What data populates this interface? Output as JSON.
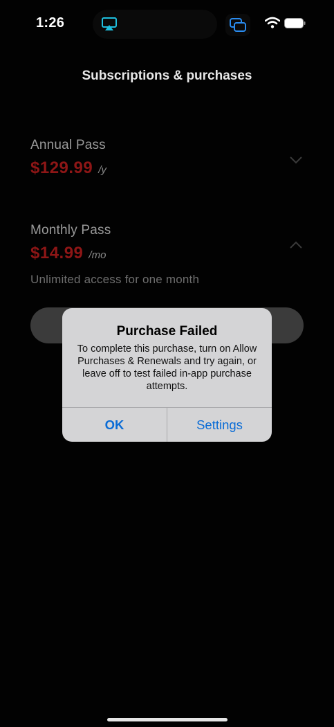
{
  "status_bar": {
    "time": "1:26"
  },
  "page": {
    "title": "Subscriptions & purchases"
  },
  "plans": [
    {
      "title": "Annual Pass",
      "price": "$129.99",
      "period": "/y",
      "expanded": false
    },
    {
      "title": "Monthly Pass",
      "price": "$14.99",
      "period": "/mo",
      "description": "Unlimited access for one month",
      "expanded": true
    }
  ],
  "alert": {
    "title": "Purchase Failed",
    "message": "To complete this purchase, turn on Allow Purchases & Renewals and try again, or leave off to test failed in-app purchase attempts.",
    "ok_label": "OK",
    "settings_label": "Settings"
  },
  "colors": {
    "background": "#020202",
    "price_red": "#8e1616",
    "alert_background": "#d4d4d6",
    "alert_button_blue": "#0a6cd6",
    "airplay_cyan": "#1fc0e0"
  },
  "icons": [
    "airplay-icon",
    "screen-mirror-icon",
    "wifi-icon",
    "battery-icon",
    "chevron-down-icon",
    "chevron-up-icon"
  ]
}
